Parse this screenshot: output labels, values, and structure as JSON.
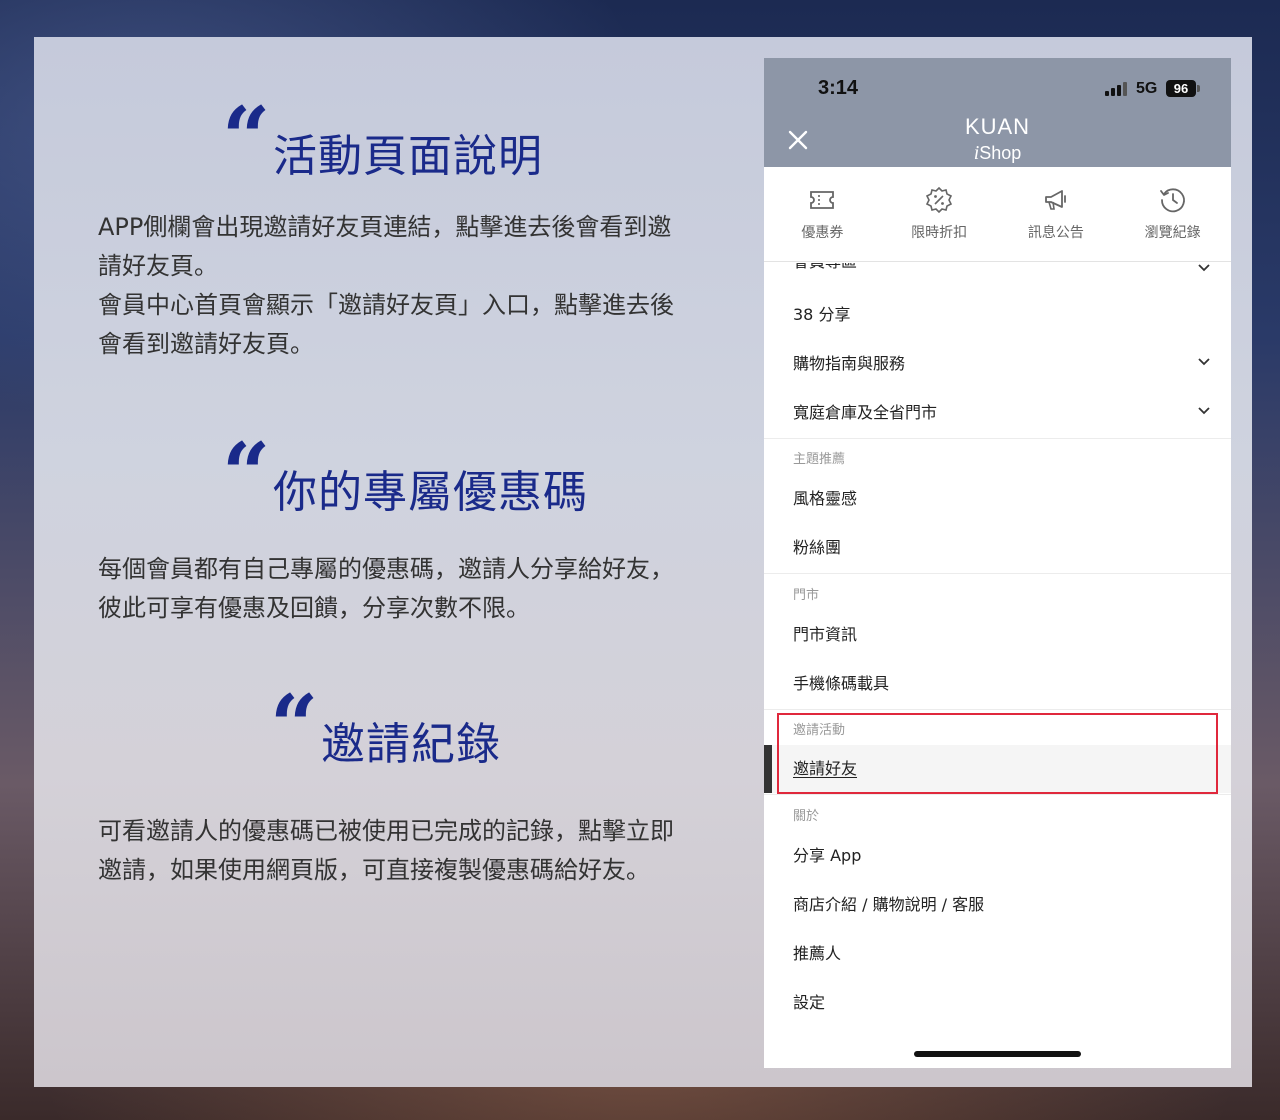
{
  "left": {
    "sections": [
      {
        "heading": "活動頁面說明",
        "paragraphs": [
          "APP側欄會出現邀請好友頁連結，點擊進去後會看到邀請好友頁。",
          "會員中心首頁會顯示「邀請好友頁」入口，點擊進去後會看到邀請好友頁。"
        ]
      },
      {
        "heading": "你的專屬優惠碼",
        "paragraphs": [
          "每個會員都有自己專屬的優惠碼，邀請人分享給好友，彼此可享有優惠及回饋，分享次數不限。"
        ]
      },
      {
        "heading": "邀請紀錄",
        "paragraphs": [
          "可看邀請人的優惠碼已被使用已完成的記錄，點擊立即邀請，如果使用網頁版，可直接複製優惠碼給好友。"
        ]
      }
    ],
    "quote_glyph": "“"
  },
  "phone": {
    "status": {
      "time": "3:14",
      "network": "5G",
      "battery": "96"
    },
    "header": {
      "brand": "KUAN",
      "brand_sub_italic": "i",
      "brand_sub_rest": "Shop",
      "close_icon": "close-icon"
    },
    "quick_links": [
      {
        "label": "優惠券",
        "icon": "coupon-icon"
      },
      {
        "label": "限時折扣",
        "icon": "discount-badge-icon"
      },
      {
        "label": "訊息公告",
        "icon": "megaphone-icon"
      },
      {
        "label": "瀏覽紀錄",
        "icon": "history-icon"
      }
    ],
    "menu": {
      "top_items": [
        {
          "label": "會員專區",
          "expandable": true
        },
        {
          "label": "38 分享",
          "expandable": false
        },
        {
          "label": "購物指南與服務",
          "expandable": true
        },
        {
          "label": "寬庭倉庫及全省門市",
          "expandable": true
        }
      ],
      "theme_label": "主題推薦",
      "theme_items": [
        "風格靈感",
        "粉絲團"
      ],
      "store_label": "門市",
      "store_items": [
        "門市資訊",
        "手機條碼載具"
      ],
      "invite_label": "邀請活動",
      "invite_items": [
        "邀請好友"
      ],
      "about_label": "關於",
      "about_items": [
        "分享 App",
        "商店介紹 / 購物說明 / 客服",
        "推薦人",
        "設定"
      ]
    }
  },
  "colors": {
    "heading_blue": "#1a2a8a",
    "header_gray": "#8d96a7",
    "highlight_red": "#e0283c"
  }
}
